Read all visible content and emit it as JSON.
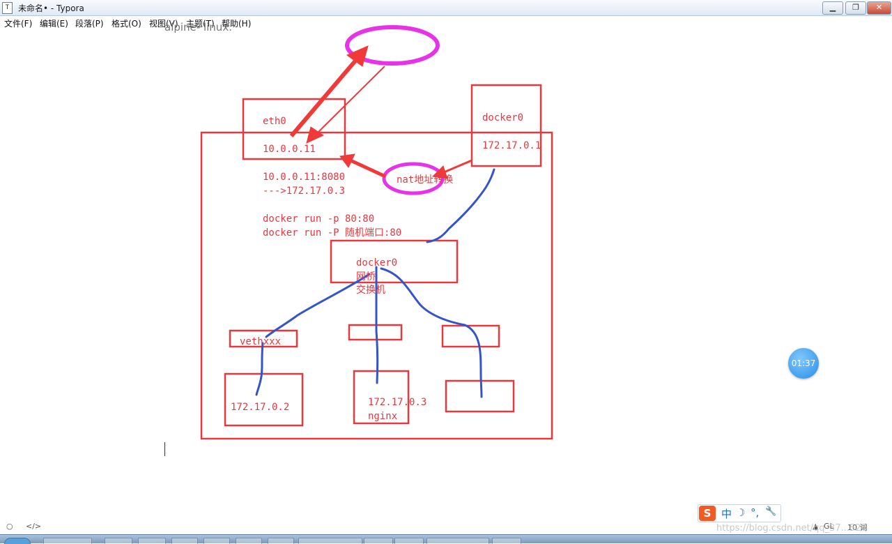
{
  "window": {
    "icon_glyph": "T",
    "title": "未命名• - Typora",
    "minimize_glyph": "▁",
    "maximize_glyph": "❐",
    "close_glyph": "✕"
  },
  "menu": [
    "文件(F)",
    "编辑(E)",
    "段落(P)",
    "格式(O)",
    "视图(V)",
    "主题(T)",
    "帮助(H)"
  ],
  "editor": {
    "cut_text": "alpine- linux."
  },
  "diagram": {
    "eth0_label": "eth0",
    "eth0_ip": "10.0.0.11",
    "docker0_host_label": "docker0",
    "docker0_ip": "172.17.0.1",
    "port_map_line1": "10.0.0.11:8080",
    "port_map_line2": "--->172.17.0.3",
    "cmd_line1": "docker run -p 80:80",
    "cmd_line2": "docker run -P 随机端口:80",
    "nat_label": "nat地址转换",
    "bridge_label1": "docker0",
    "bridge_label2": "网桥",
    "bridge_label3": "交换机",
    "veth_label": "vethxxx",
    "container1_ip": "172.17.0.2",
    "container2_ip": "172.17.0.3",
    "container2_name": "nginx"
  },
  "timer": "01:37",
  "ime": {
    "logo": "S",
    "glyph1": "中",
    "glyph2": "☽",
    "glyph3": "°,",
    "glyph4": "🔧"
  },
  "status_bar": {
    "circle_glyph": "○",
    "source_glyph": "</>",
    "gl_label": "GL",
    "word_count": "10 词"
  },
  "watermark": "https://blog.csdn.net/qq_37...520",
  "colors": {
    "accent_red": "#e5393f",
    "pen_blue": "#3554c8",
    "magenta": "#e832e8"
  }
}
